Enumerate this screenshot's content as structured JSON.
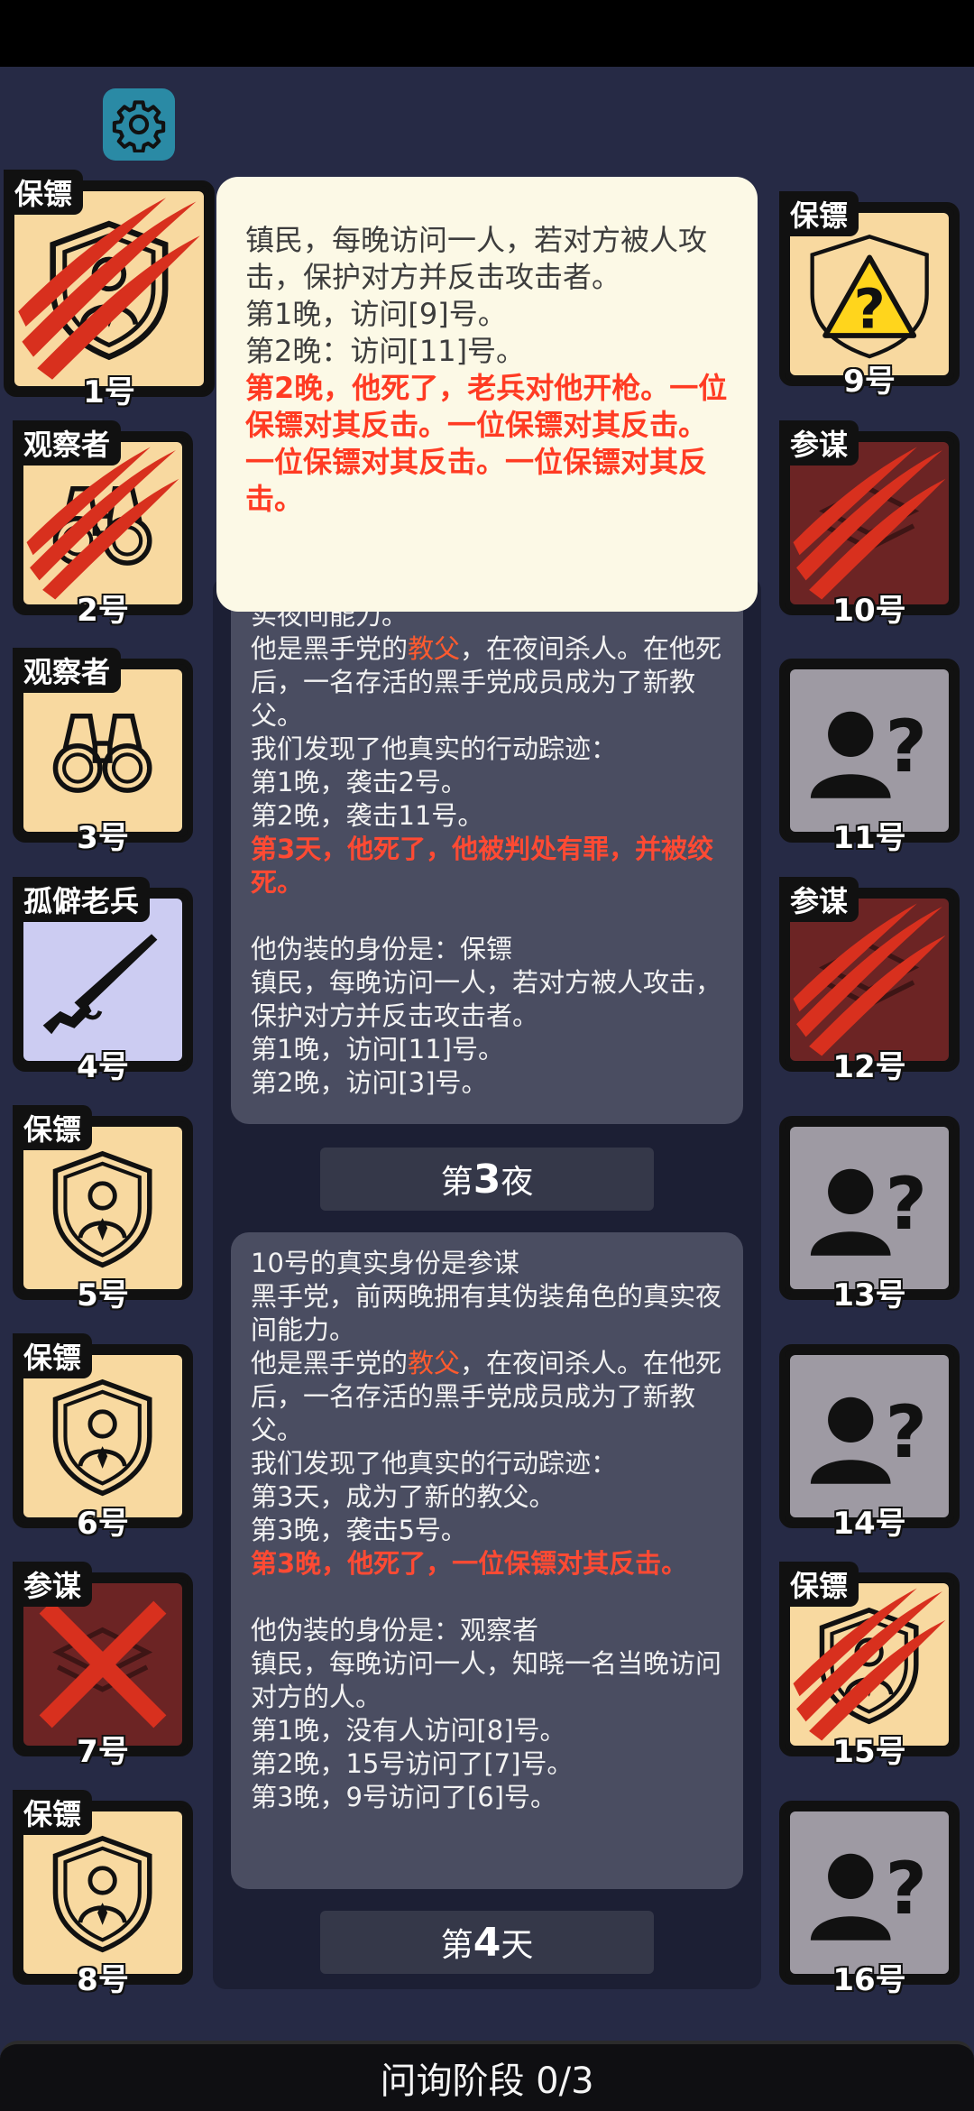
{
  "settings": {
    "icon": "gear-icon"
  },
  "players_left": [
    {
      "num": "1号",
      "role": "保镖",
      "face": "tan",
      "icon": "shield-person-icon",
      "status": "killed"
    },
    {
      "num": "2号",
      "role": "观察者",
      "face": "tan",
      "icon": "binoculars-icon",
      "status": "killed"
    },
    {
      "num": "3号",
      "role": "观察者",
      "face": "tan",
      "icon": "binoculars-icon",
      "status": "alive"
    },
    {
      "num": "4号",
      "role": "孤僻老兵",
      "face": "lav",
      "icon": "rifle-icon",
      "status": "alive"
    },
    {
      "num": "5号",
      "role": "保镖",
      "face": "tan",
      "icon": "shield-person-icon",
      "status": "alive"
    },
    {
      "num": "6号",
      "role": "保镖",
      "face": "tan",
      "icon": "shield-person-icon",
      "status": "alive"
    },
    {
      "num": "7号",
      "role": "参谋",
      "face": "red",
      "icon": "strategy-map-icon",
      "status": "executed"
    },
    {
      "num": "8号",
      "role": "保镖",
      "face": "tan",
      "icon": "shield-person-icon",
      "status": "alive"
    }
  ],
  "players_right": [
    {
      "num": "9号",
      "role": "保镖",
      "face": "tan",
      "icon": "warning-question-icon",
      "status": "alive"
    },
    {
      "num": "10号",
      "role": "参谋",
      "face": "red",
      "icon": "strategy-map-icon",
      "status": "killed"
    },
    {
      "num": "11号",
      "role": "",
      "face": "gray",
      "icon": "unknown-person-icon",
      "status": "unknown"
    },
    {
      "num": "12号",
      "role": "参谋",
      "face": "red",
      "icon": "strategy-map-icon",
      "status": "killed"
    },
    {
      "num": "13号",
      "role": "",
      "face": "gray",
      "icon": "unknown-person-icon",
      "status": "unknown"
    },
    {
      "num": "14号",
      "role": "",
      "face": "gray",
      "icon": "unknown-person-icon",
      "status": "unknown"
    },
    {
      "num": "15号",
      "role": "保镖",
      "face": "tan",
      "icon": "shield-person-icon",
      "status": "killed"
    },
    {
      "num": "16号",
      "role": "",
      "face": "gray",
      "icon": "unknown-person-icon",
      "status": "unknown"
    }
  ],
  "tooltip": {
    "lines": [
      "镇民，每晚访问一人，若对方被人攻击，保护对方并反击攻击者。",
      "第1晚，访问[9]号。",
      "第2晚：访问[11]号。"
    ],
    "death": "第2晚，他死了，老兵对他开枪。一位保镖对其反击。一位保镖对其反击。一位保镖对其反击。一位保镖对其反击。"
  },
  "log1": {
    "partial": "实夜间能力。",
    "godfather_a": "他是黑手党的",
    "godfather_role": "教父",
    "godfather_b": "，在夜间杀人。在他死后，一名存活的黑手党成员成为了新教父。",
    "trace_title": "我们发现了他真实的行动踪迹：",
    "traces": [
      "第1晚，袭击2号。",
      "第2晚，袭击11号。"
    ],
    "death": "第3天，他死了，他被判处有罪，并被绞死。",
    "disguise_title": "他伪装的身份是：保镖",
    "disguise_desc": "镇民，每晚访问一人，若对方被人攻击，保护对方并反击攻击者。",
    "disguise_visits": [
      "第1晚，访问[11]号。",
      "第2晚，访问[3]号。"
    ]
  },
  "phase1": {
    "prefix": "第",
    "number": "3",
    "suffix": "夜"
  },
  "log2": {
    "header": "10号的真实身份是参谋",
    "desc": "黑手党，前两晚拥有其伪装角色的真实夜间能力。",
    "godfather_a": "他是黑手党的",
    "godfather_role": "教父",
    "godfather_b": "，在夜间杀人。在他死后，一名存活的黑手党成员成为了新教父。",
    "trace_title": "我们发现了他真实的行动踪迹：",
    "traces": [
      "第3天，成为了新的教父。",
      "第3晚，袭击5号。"
    ],
    "death": "第3晚，他死了，一位保镖对其反击。",
    "disguise_title": "他伪装的身份是：观察者",
    "disguise_desc": "镇民，每晚访问一人，知晓一名当晚访问对方的人。",
    "disguise_visits": [
      "第1晚，没有人访问[8]号。",
      "第2晚，15号访问了[7]号。",
      "第3晚，9号访问了[6]号。"
    ]
  },
  "phase2": {
    "prefix": "第",
    "number": "4",
    "suffix": "天"
  },
  "bottom": {
    "label": "问询阶段 0/3"
  }
}
